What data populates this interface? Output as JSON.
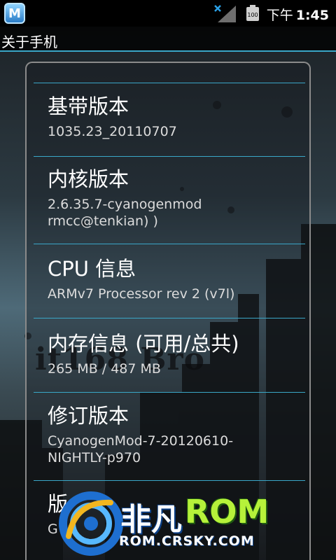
{
  "status_bar": {
    "app_icon_letter": "M",
    "signal_icon": "signal-off-icon",
    "battery_icon": "battery-icon",
    "battery_text": "100",
    "time_period": "下午",
    "time": "1:45"
  },
  "title": "关于手机",
  "items": [
    {
      "title": "基带版本",
      "value": "1035.23_20110707"
    },
    {
      "title": "内核版本",
      "value_lines": [
        "2.6.35.7-cyanogenmod",
        "rmcc@tenkian) )"
      ]
    },
    {
      "title": "CPU 信息",
      "value": " ARMv7 Processor rev 2 (v7l)"
    },
    {
      "title": "内存信息 (可用/总共)",
      "value": "265 MB / 487 MB"
    },
    {
      "title": "修订版本",
      "value_lines": [
        "CyanogenMod-7-20120610-",
        "NIGHTLY-p970"
      ]
    },
    {
      "title": "版",
      "value": "G"
    }
  ],
  "watermark": {
    "text": "it168 Bro",
    "logo_cn": "非凡",
    "logo_rom": "ROM",
    "logo_url": "ROM.CRSKY.COM"
  },
  "colors": {
    "accent": "#3aa7c8",
    "logo_green": "#b6f23a",
    "logo_blue": "#0b3f86"
  }
}
